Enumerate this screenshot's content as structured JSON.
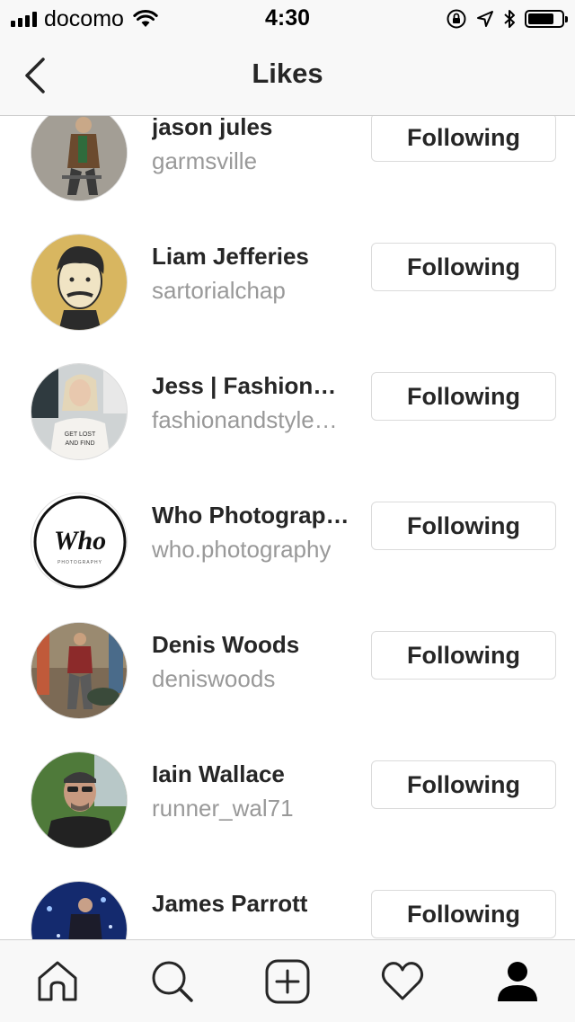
{
  "status_bar": {
    "carrier": "docomo",
    "time": "4:30"
  },
  "nav": {
    "title": "Likes"
  },
  "users": [
    {
      "name": "jason jules",
      "username": "garmsville",
      "button": "Following"
    },
    {
      "name": "Liam Jefferies",
      "username": "sartorialchap",
      "button": "Following"
    },
    {
      "name": "Jess | Fashion…",
      "username": "fashionandstyle…",
      "button": "Following"
    },
    {
      "name": "Who Photograp…",
      "username": "who.photography",
      "button": "Following",
      "avatar_text": "Who",
      "avatar_subtext": "PHOTOGRAPHY"
    },
    {
      "name": "Denis Woods",
      "username": "deniswoods",
      "button": "Following"
    },
    {
      "name": "Iain Wallace",
      "username": "runner_wal71",
      "button": "Following"
    },
    {
      "name": "James Parrott",
      "username": "",
      "button": "Following"
    }
  ],
  "tab_bar": {
    "items": [
      "home-icon",
      "search-icon",
      "add-post-icon",
      "activity-heart-icon",
      "profile-icon"
    ],
    "active": "profile-icon"
  }
}
